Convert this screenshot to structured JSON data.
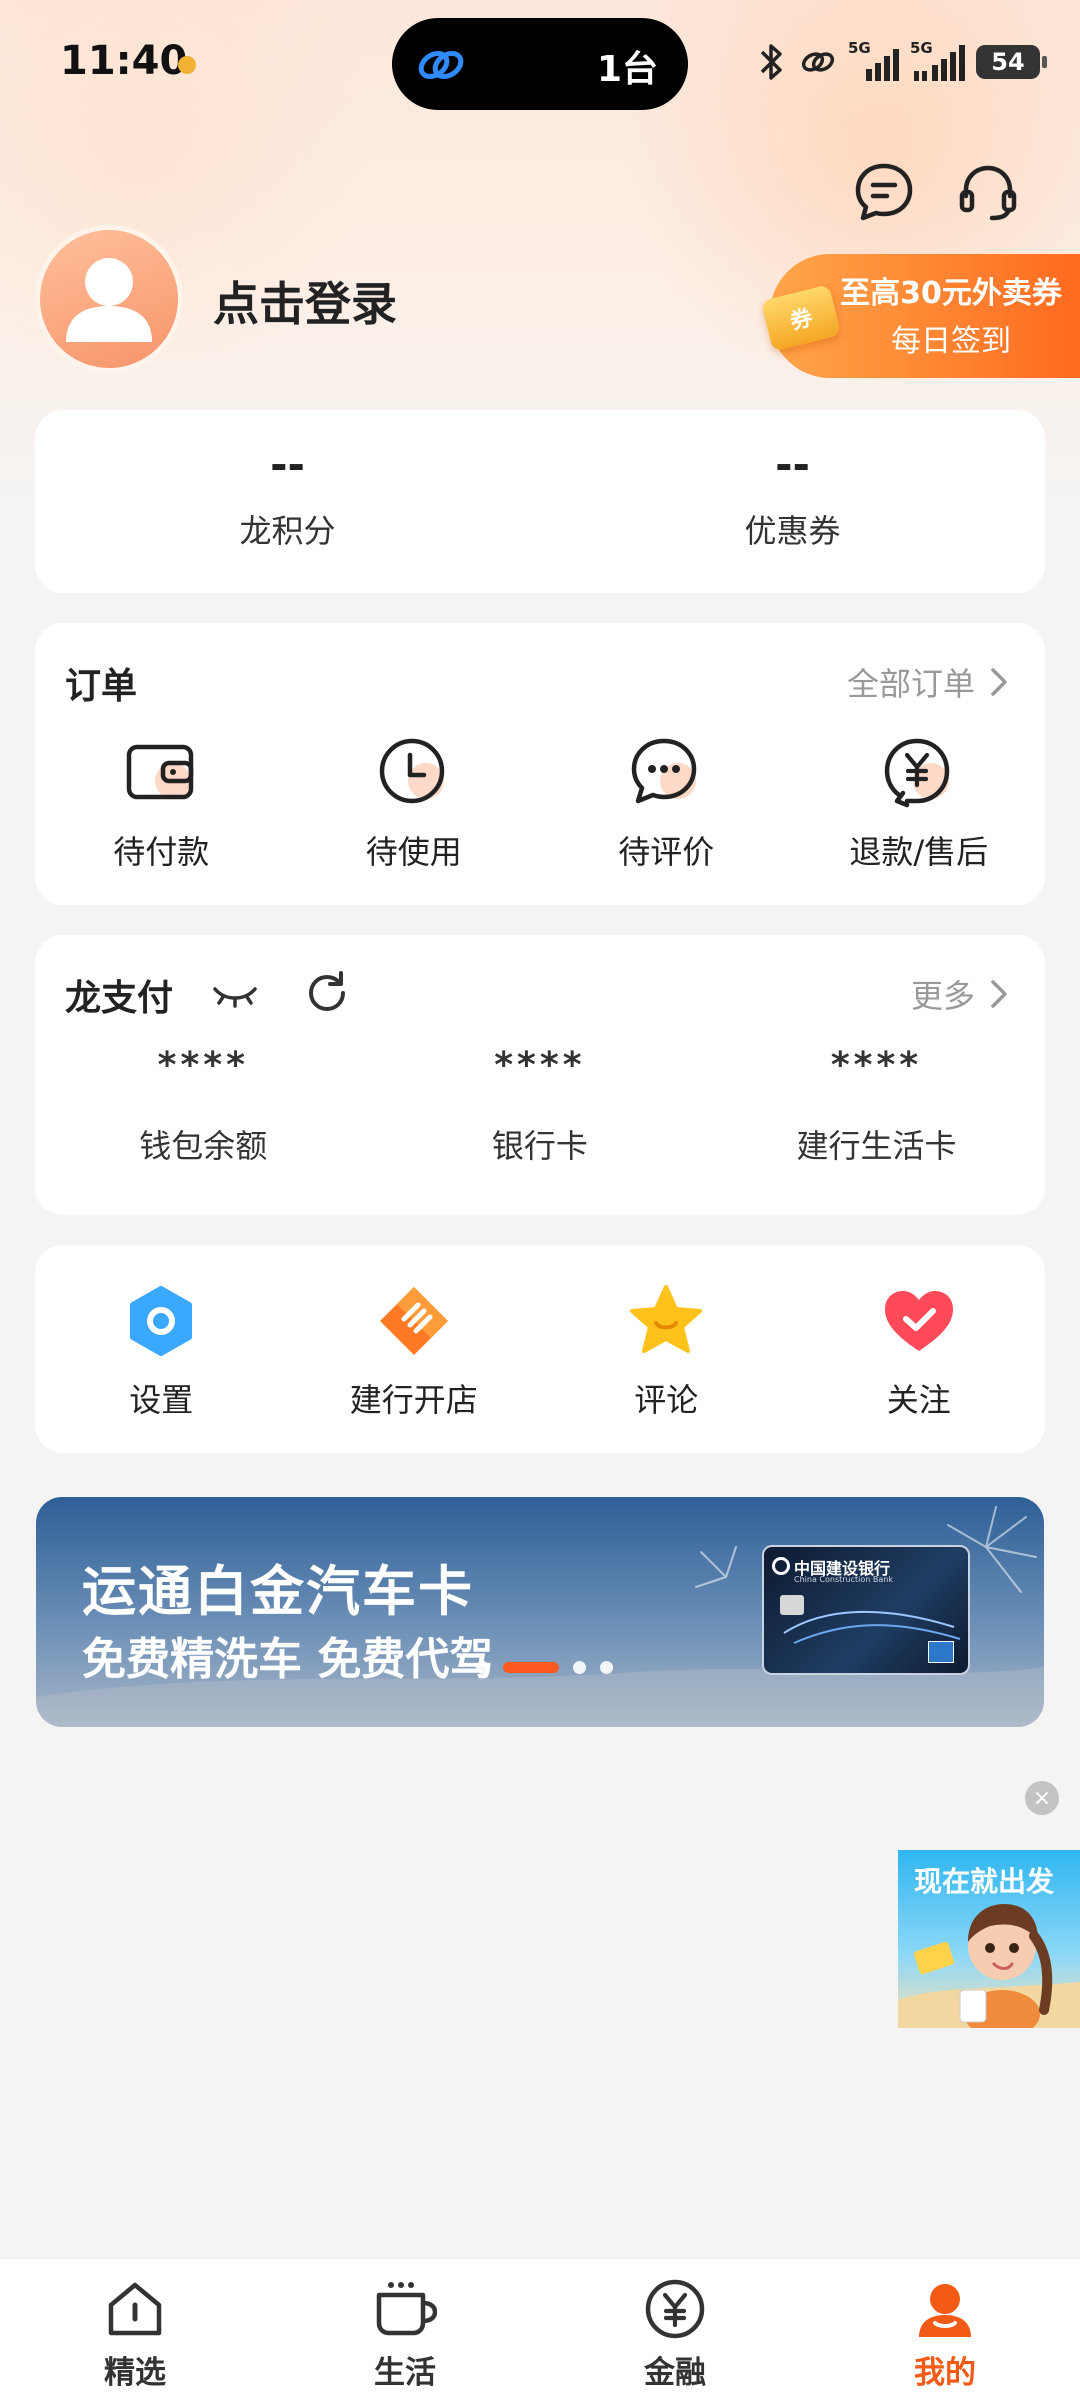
{
  "status_bar": {
    "time": "11:40",
    "island_count": "1台",
    "battery": "54",
    "signal_labels": [
      "5G",
      "5G"
    ]
  },
  "profile": {
    "login_text": "点击登录",
    "checkin_line1": "至高30元外卖券",
    "checkin_line2": "每日签到",
    "coupon_tag": "券"
  },
  "points": [
    {
      "value": "--",
      "label": "龙积分"
    },
    {
      "value": "--",
      "label": "优惠券"
    }
  ],
  "orders": {
    "title": "订单",
    "more_label": "全部订单",
    "items": [
      {
        "label": "待付款",
        "icon": "wallet-icon"
      },
      {
        "label": "待使用",
        "icon": "clock-icon"
      },
      {
        "label": "待评价",
        "icon": "comment-icon"
      },
      {
        "label": "退款/售后",
        "icon": "refund-icon"
      }
    ]
  },
  "pay": {
    "title": "龙支付",
    "more_label": "更多",
    "items": [
      {
        "value": "****",
        "label": "钱包余额"
      },
      {
        "value": "****",
        "label": "银行卡"
      },
      {
        "value": "****",
        "label": "建行生活卡"
      }
    ]
  },
  "tools": {
    "items": [
      {
        "label": "设置",
        "icon": "settings-icon"
      },
      {
        "label": "建行开店",
        "icon": "shop-icon"
      },
      {
        "label": "评论",
        "icon": "star-icon"
      },
      {
        "label": "关注",
        "icon": "heart-icon"
      }
    ]
  },
  "promo": {
    "title": "运通白金汽车卡",
    "subtitle": "免费精洗车 免费代驾",
    "card_bank_name": "中国建设银行",
    "card_bank_name_en": "China Construction Bank"
  },
  "float_ad": {
    "text": "现在就出发",
    "close": "×"
  },
  "tabs": [
    {
      "label": "精选",
      "icon": "home-icon"
    },
    {
      "label": "生活",
      "icon": "cup-icon"
    },
    {
      "label": "金融",
      "icon": "yuan-icon"
    },
    {
      "label": "我的",
      "icon": "profile-icon",
      "active": true
    }
  ],
  "colors": {
    "accent": "#f25a16",
    "checkin_banner": "#ff7a2a",
    "promo_blue": "#2e5f96"
  }
}
